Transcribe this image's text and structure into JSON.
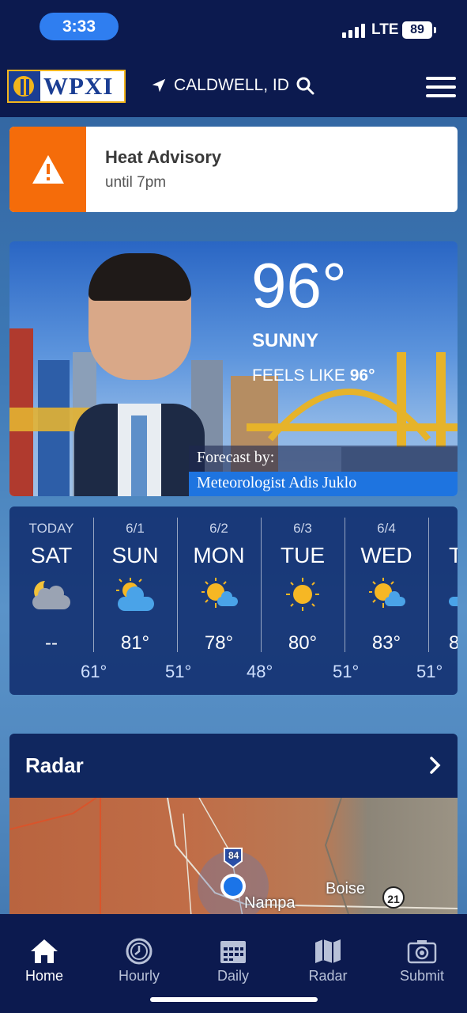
{
  "status_bar": {
    "time": "3:33",
    "network": "LTE",
    "battery": "89"
  },
  "header": {
    "logo_text": "WPXI",
    "location": "CALDWELL, ID"
  },
  "advisory": {
    "title": "Heat Advisory",
    "subtitle": "until 7pm"
  },
  "current": {
    "temperature": "96°",
    "condition": "SUNNY",
    "feels_like_label": "FEELS LIKE",
    "feels_like_value": "96°",
    "forecast_by": "Forecast by:",
    "meteorologist": "Meteorologist Adis Juklo"
  },
  "forecast": {
    "days": [
      {
        "date": "TODAY",
        "name": "SAT",
        "icon": "moon-cloud-icon",
        "high": "--",
        "low": "61°"
      },
      {
        "date": "6/1",
        "name": "SUN",
        "icon": "partly-cloudy-icon",
        "high": "81°",
        "low": "51°"
      },
      {
        "date": "6/2",
        "name": "MON",
        "icon": "mostly-sunny-icon",
        "high": "78°",
        "low": "48°"
      },
      {
        "date": "6/3",
        "name": "TUE",
        "icon": "sun-icon",
        "high": "80°",
        "low": "51°"
      },
      {
        "date": "6/4",
        "name": "WED",
        "icon": "mostly-sunny-icon",
        "high": "83°",
        "low": "51°"
      },
      {
        "date": "",
        "name": "T",
        "icon": "mostly-sunny-icon",
        "high": "8",
        "low": ""
      }
    ]
  },
  "radar": {
    "title": "Radar",
    "map_labels": {
      "highway": "84",
      "city1": "Nampa",
      "city2": "Boise",
      "route": "21"
    }
  },
  "tabs": [
    {
      "label": "Home",
      "icon": "home-icon",
      "active": true
    },
    {
      "label": "Hourly",
      "icon": "clock-icon",
      "active": false
    },
    {
      "label": "Daily",
      "icon": "calendar-icon",
      "active": false
    },
    {
      "label": "Radar",
      "icon": "map-icon",
      "active": false
    },
    {
      "label": "Submit",
      "icon": "camera-icon",
      "active": false
    }
  ],
  "colors": {
    "header_bg": "#0c1a4f",
    "accent_blue": "#2f7ef0",
    "advisory_orange": "#f56c0a"
  }
}
